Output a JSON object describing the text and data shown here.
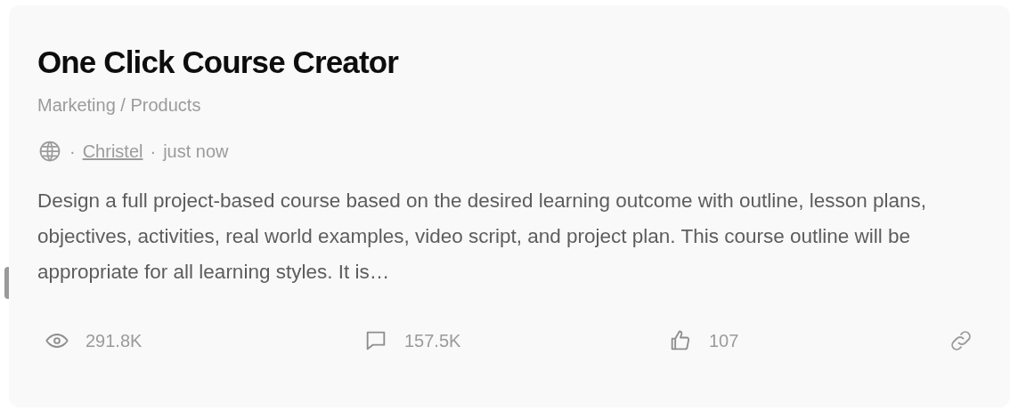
{
  "title": "One Click Course Creator",
  "category": "Marketing / Products",
  "meta": {
    "separator": "·",
    "author": "Christel",
    "time": "just now"
  },
  "description": "Design a full project-based course based on the desired learning outcome with outline, lesson plans, objectives, activities, real world examples, video script, and project plan. This course outline will be appropriate for all learning styles. It is…",
  "stats": [
    {
      "kind": "views",
      "value": "291.8K"
    },
    {
      "kind": "comments",
      "value": "157.5K"
    },
    {
      "kind": "likes",
      "value": "107"
    }
  ]
}
